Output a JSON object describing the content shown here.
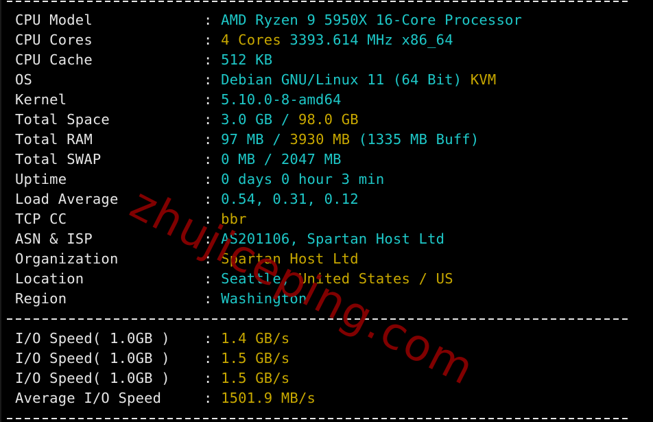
{
  "system_info": [
    {
      "label": "CPU Model",
      "parts": [
        {
          "text": "AMD Ryzen 9 5950X 16-Core Processor",
          "color": "cyan"
        }
      ]
    },
    {
      "label": "CPU Cores",
      "parts": [
        {
          "text": "4 Cores",
          "color": "yellow"
        },
        {
          "text": " 3393.614 MHz x86_64",
          "color": "cyan"
        }
      ]
    },
    {
      "label": "CPU Cache",
      "parts": [
        {
          "text": "512 KB",
          "color": "cyan"
        }
      ]
    },
    {
      "label": "OS",
      "parts": [
        {
          "text": "Debian GNU/Linux 11 (64 Bit)",
          "color": "cyan"
        },
        {
          "text": " KVM",
          "color": "yellow"
        }
      ]
    },
    {
      "label": "Kernel",
      "parts": [
        {
          "text": "5.10.0-8-amd64",
          "color": "cyan"
        }
      ]
    },
    {
      "label": "Total Space",
      "parts": [
        {
          "text": "3.0 GB / ",
          "color": "cyan"
        },
        {
          "text": "98.0 GB",
          "color": "yellow"
        }
      ]
    },
    {
      "label": "Total RAM",
      "parts": [
        {
          "text": "97 MB / ",
          "color": "cyan"
        },
        {
          "text": "3930 MB",
          "color": "yellow"
        },
        {
          "text": " (1335 MB Buff)",
          "color": "cyan"
        }
      ]
    },
    {
      "label": "Total SWAP",
      "parts": [
        {
          "text": "0 MB / 2047 MB",
          "color": "cyan"
        }
      ]
    },
    {
      "label": "Uptime",
      "parts": [
        {
          "text": "0 days 0 hour 3 min",
          "color": "cyan"
        }
      ]
    },
    {
      "label": "Load Average",
      "parts": [
        {
          "text": "0.54, 0.31, 0.12",
          "color": "cyan"
        }
      ]
    },
    {
      "label": "TCP CC",
      "parts": [
        {
          "text": "bbr",
          "color": "yellow"
        }
      ]
    },
    {
      "label": "ASN & ISP",
      "parts": [
        {
          "text": "AS201106, Spartan Host Ltd",
          "color": "cyan"
        }
      ]
    },
    {
      "label": "Organization",
      "parts": [
        {
          "text": "Spartan Host Ltd",
          "color": "yellow"
        }
      ]
    },
    {
      "label": "Location",
      "parts": [
        {
          "text": "Seattle,",
          "color": "cyan"
        },
        {
          "text": " United States / US",
          "color": "yellow"
        }
      ]
    },
    {
      "label": "Region",
      "parts": [
        {
          "text": "Washington",
          "color": "cyan"
        }
      ]
    }
  ],
  "io_info": [
    {
      "label": "I/O Speed( 1.0GB )",
      "parts": [
        {
          "text": "1.4 GB/s",
          "color": "yellow"
        }
      ]
    },
    {
      "label": "I/O Speed( 1.0GB )",
      "parts": [
        {
          "text": "1.5 GB/s",
          "color": "yellow"
        }
      ]
    },
    {
      "label": "I/O Speed( 1.0GB )",
      "parts": [
        {
          "text": "1.5 GB/s",
          "color": "yellow"
        }
      ]
    },
    {
      "label": "Average I/O Speed",
      "parts": [
        {
          "text": "1501.9 MB/s",
          "color": "yellow"
        }
      ]
    }
  ],
  "separator": ":",
  "watermark": "zhujiceping.com",
  "colors": {
    "cyan": "#1ec8c8",
    "yellow": "#c8a800",
    "label": "#e6e6e6",
    "background": "#000000",
    "watermark": "#8b0000"
  }
}
